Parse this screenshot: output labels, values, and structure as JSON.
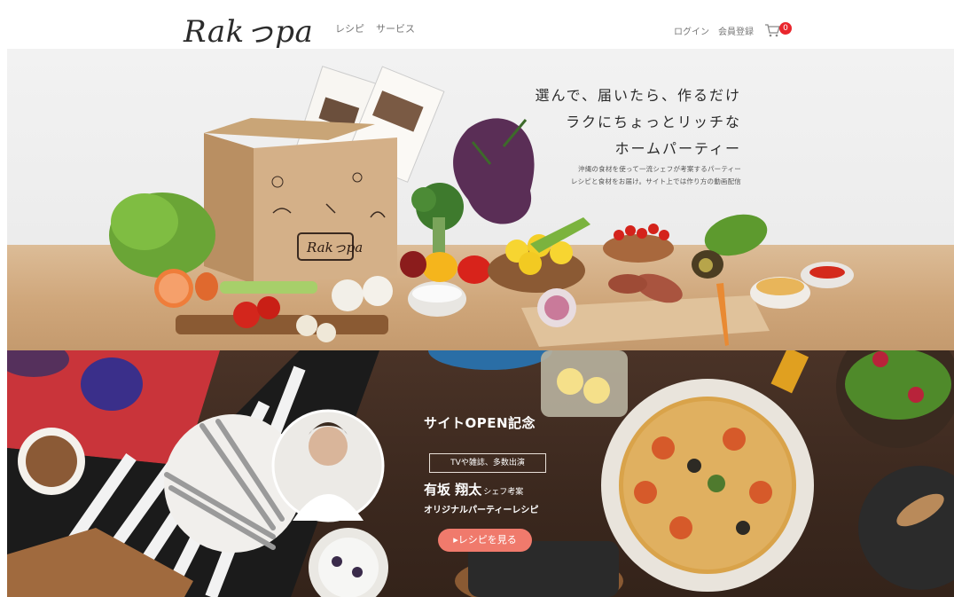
{
  "header": {
    "logo": "Rakっpa",
    "nav": {
      "recipe": "レシピ",
      "service": "サービス"
    },
    "login": "ログイン",
    "register": "会員登録",
    "cart_count": "0"
  },
  "hero": {
    "lines": [
      "選んで、届いたら、作るだけ",
      "ラクにちょっとリッチな",
      "ホームパーティー"
    ],
    "desc": [
      "沖縄の食材を使って一流シェフが考案するパーティー",
      "レシピと食材をお届け。サイト上では作り方の動画配信"
    ],
    "box_logo": "Rakっpa"
  },
  "promo": {
    "title": "サイトOPEN記念",
    "tv": "TVや雑誌、多数出演",
    "chef_name": "有坂 翔太",
    "chef_suffix": "シェフ考案",
    "subtitle": "オリジナルパーティーレシピ",
    "button": "▸レシピを見る"
  },
  "colors": {
    "accent": "#f07a6c",
    "cart_badge": "#e9262d",
    "table_wood": "#cfa67a",
    "dark_wood": "#3b281e"
  }
}
